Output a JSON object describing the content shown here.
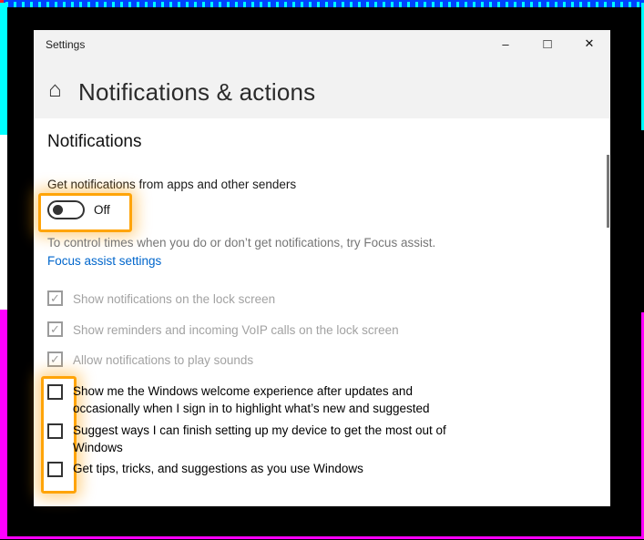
{
  "frame": {
    "top_pattern": "blue-dashes-on-cyan",
    "colors": {
      "blue": "#0042FF",
      "cyan": "#00FFFF",
      "magenta": "#FF00FF",
      "corner_red": "#FF1F1F",
      "backdrop": "#000000"
    }
  },
  "icons": {
    "home": "⌂",
    "minimize": "–",
    "maximize": "□",
    "close": "✕",
    "checkmark": "✓"
  },
  "colors": {
    "highlight_orange": "#FFA408",
    "link_blue": "#0066CC",
    "hint_gray": "#767676",
    "disabled_gray": "#9B9B9B",
    "titlebar_gray": "#F2F2F2",
    "scrollbar_gray": "#787878"
  },
  "window": {
    "title": "Settings",
    "page_title": "Notifications & actions",
    "section_title": "Notifications",
    "toggle": {
      "caption": "Get notifications from apps and other senders",
      "state": "Off",
      "on": false
    },
    "focus_assist": {
      "hint": "To control times when you do or don’t get notifications, try Focus assist.",
      "link": "Focus assist settings"
    },
    "locked_options": [
      {
        "label": "Show notifications on the lock screen",
        "checked": true,
        "enabled": false
      },
      {
        "label": "Show reminders and incoming VoIP calls on the lock screen",
        "checked": true,
        "enabled": false
      },
      {
        "label": "Allow notifications to play sounds",
        "checked": true,
        "enabled": false
      }
    ],
    "open_options": [
      {
        "label": "Show me the Windows welcome experience after updates and occasionally when I sign in to highlight what’s new and suggested",
        "checked": false,
        "enabled": true
      },
      {
        "label": "Suggest ways I can finish setting up my device to get the most out of Windows",
        "checked": false,
        "enabled": true
      },
      {
        "label": "Get tips, tricks, and suggestions as you use Windows",
        "checked": false,
        "enabled": true
      }
    ]
  }
}
